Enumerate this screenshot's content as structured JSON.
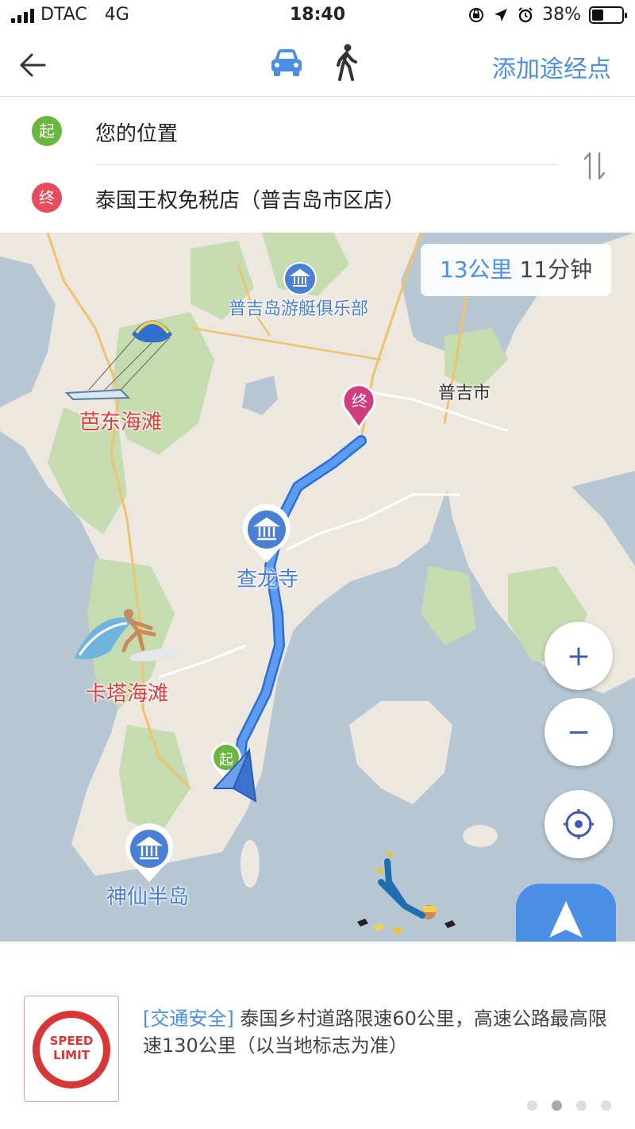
{
  "status_bar": {
    "carrier": "DTAC",
    "network": "4G",
    "time": "18:40",
    "battery_percent": "38%",
    "battery_level": 0.38
  },
  "nav": {
    "back_icon": "back-arrow-icon",
    "modes": [
      {
        "name": "car",
        "icon": "car-icon",
        "active": true
      },
      {
        "name": "walk",
        "icon": "walk-icon",
        "active": false
      }
    ],
    "add_waypoint": "添加途经点"
  },
  "route": {
    "start_badge": "起",
    "start": "您的位置",
    "end_badge": "终",
    "end": "泰国王权免税店（普吉岛市区店）",
    "swap_icon": "swap-icon"
  },
  "map": {
    "distance": "13公里",
    "duration": "11分钟",
    "labels": {
      "yacht_club": "普吉岛游艇俱乐部",
      "city": "普吉市",
      "patong": "芭东海滩",
      "chalong": "查龙寺",
      "kata": "卡塔海滩",
      "promthep": "神仙半岛"
    },
    "end_pin": "终",
    "start_pin": "起",
    "zoom_in": "+",
    "zoom_out": "−",
    "navigate": "导航",
    "colors": {
      "water": "#b6c7d3",
      "land": "#ede8df",
      "green": "#c5dcb1",
      "route": "#4a8ee6",
      "accent": "#4a8ee6"
    }
  },
  "tips": {
    "sign_line1": "SPEED",
    "sign_line2": "LIMIT",
    "tag": "[交通安全]",
    "text": "泰国乡村道路限速60公里，高速公路最高限速130公里（以当地标志为准）",
    "page_count": 4,
    "active_page": 2
  }
}
